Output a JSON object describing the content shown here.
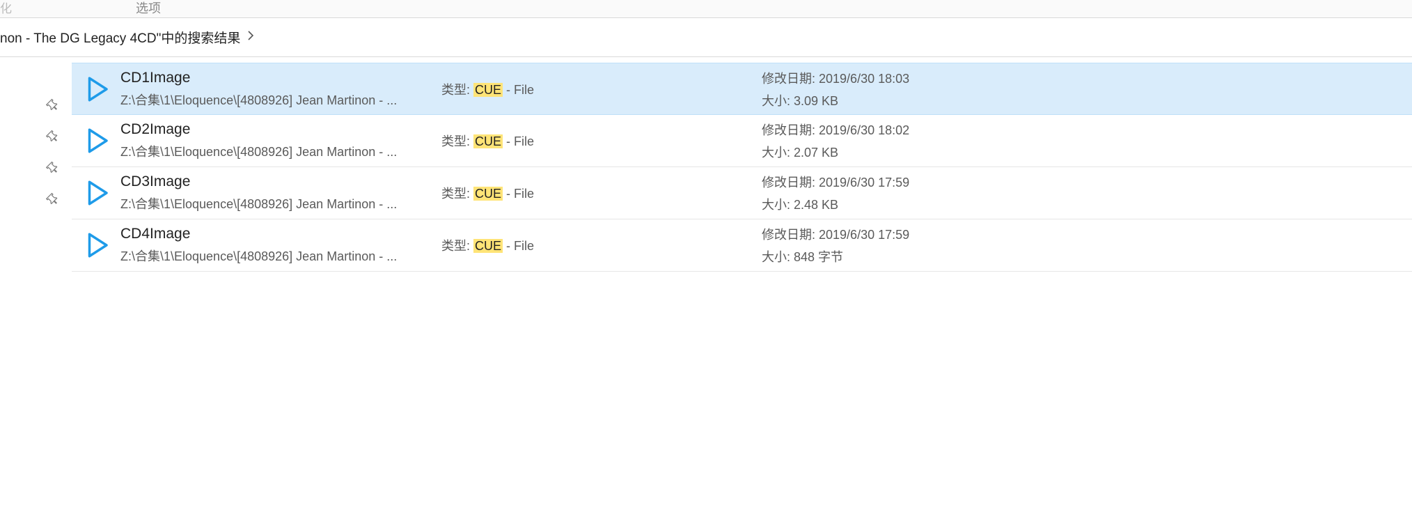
{
  "ribbon": {
    "partial_tab": "化",
    "options_label": "选项"
  },
  "breadcrumb": {
    "text": "non - The DG Legacy 4CD\"中的搜索结果"
  },
  "labels": {
    "type_label": "类型: ",
    "type_suffix": " - File",
    "highlight": "CUE",
    "date_label": "修改日期: ",
    "size_label": "大小: "
  },
  "files": [
    {
      "name": "CD1Image",
      "path": "Z:\\合集\\1\\Eloquence\\[4808926] Jean Martinon - ...",
      "date": "2019/6/30 18:03",
      "size": "3.09 KB",
      "selected": true
    },
    {
      "name": "CD2Image",
      "path": "Z:\\合集\\1\\Eloquence\\[4808926] Jean Martinon - ...",
      "date": "2019/6/30 18:02",
      "size": "2.07 KB",
      "selected": false
    },
    {
      "name": "CD3Image",
      "path": "Z:\\合集\\1\\Eloquence\\[4808926] Jean Martinon - ...",
      "date": "2019/6/30 17:59",
      "size": "2.48 KB",
      "selected": false
    },
    {
      "name": "CD4Image",
      "path": "Z:\\合集\\1\\Eloquence\\[4808926] Jean Martinon - ...",
      "date": "2019/6/30 17:59",
      "size": "848 字节",
      "selected": false
    }
  ]
}
